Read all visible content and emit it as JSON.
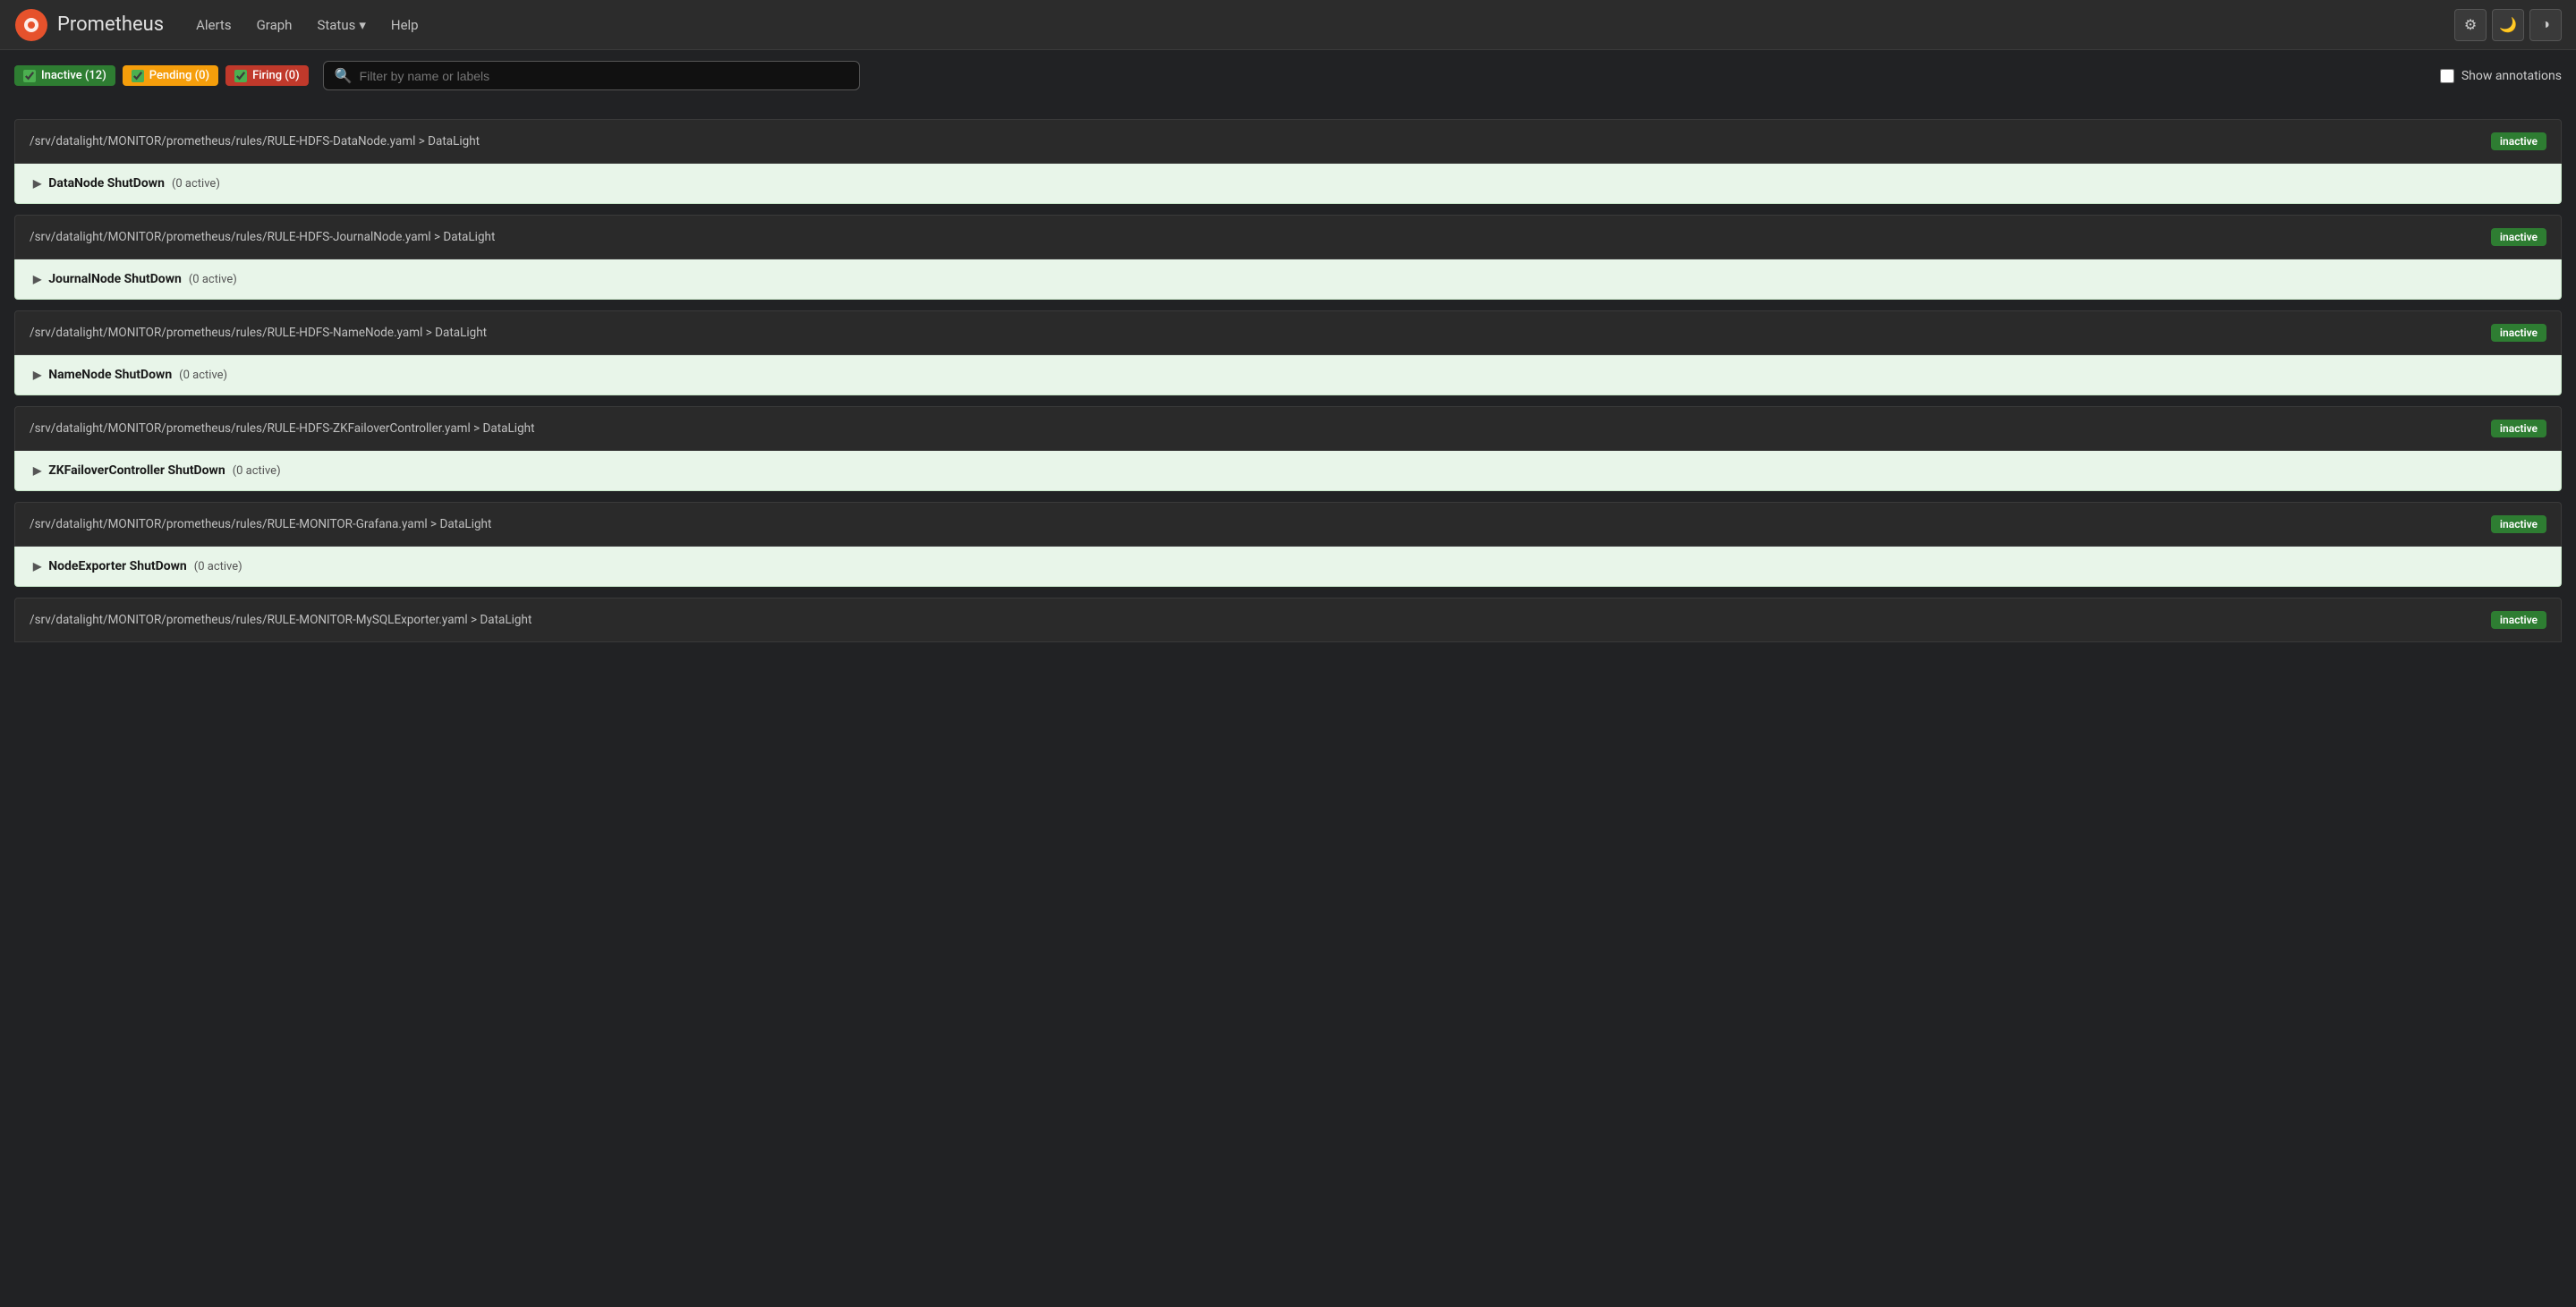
{
  "app": {
    "title": "Prometheus",
    "logo_alt": "Prometheus Logo"
  },
  "navbar": {
    "brand": "Prometheus",
    "links": [
      {
        "label": "Alerts",
        "id": "alerts"
      },
      {
        "label": "Graph",
        "id": "graph"
      },
      {
        "label": "Status",
        "id": "status",
        "dropdown": true
      },
      {
        "label": "Help",
        "id": "help"
      }
    ],
    "icons": [
      {
        "id": "settings-icon",
        "symbol": "⚙"
      },
      {
        "id": "moon-icon",
        "symbol": "🌙"
      },
      {
        "id": "contrast-icon",
        "symbol": "◑"
      }
    ]
  },
  "toolbar": {
    "badges": [
      {
        "id": "inactive-badge",
        "label": "Inactive (12)",
        "type": "inactive",
        "checked": true
      },
      {
        "id": "pending-badge",
        "label": "Pending (0)",
        "type": "pending",
        "checked": true
      },
      {
        "id": "firing-badge",
        "label": "Firing (0)",
        "type": "firing",
        "checked": true
      }
    ],
    "search_placeholder": "Filter by name or labels",
    "show_annotations_label": "Show annotations"
  },
  "rule_groups": [
    {
      "id": "rg1",
      "path": "/srv/datalight/MONITOR/prometheus/rules/RULE-HDFS-DataNode.yaml > DataLight",
      "status": "inactive",
      "rules": [
        {
          "id": "r1",
          "name": "DataNode ShutDown",
          "active_count": "0 active"
        }
      ]
    },
    {
      "id": "rg2",
      "path": "/srv/datalight/MONITOR/prometheus/rules/RULE-HDFS-JournalNode.yaml > DataLight",
      "status": "inactive",
      "rules": [
        {
          "id": "r2",
          "name": "JournalNode ShutDown",
          "active_count": "0 active"
        }
      ]
    },
    {
      "id": "rg3",
      "path": "/srv/datalight/MONITOR/prometheus/rules/RULE-HDFS-NameNode.yaml > DataLight",
      "status": "inactive",
      "rules": [
        {
          "id": "r3",
          "name": "NameNode ShutDown",
          "active_count": "0 active"
        }
      ]
    },
    {
      "id": "rg4",
      "path": "/srv/datalight/MONITOR/prometheus/rules/RULE-HDFS-ZKFailoverController.yaml > DataLight",
      "status": "inactive",
      "rules": [
        {
          "id": "r4",
          "name": "ZKFailoverController ShutDown",
          "active_count": "0 active"
        }
      ]
    },
    {
      "id": "rg5",
      "path": "/srv/datalight/MONITOR/prometheus/rules/RULE-MONITOR-Grafana.yaml > DataLight",
      "status": "inactive",
      "rules": [
        {
          "id": "r5",
          "name": "NodeExporter ShutDown",
          "active_count": "0 active"
        }
      ]
    },
    {
      "id": "rg6",
      "path": "/srv/datalight/MONITOR/prometheus/rules/RULE-MONITOR-MySQLExporter.yaml > DataLight",
      "status": "inactive",
      "rules": []
    }
  ],
  "status_label": "inactive"
}
